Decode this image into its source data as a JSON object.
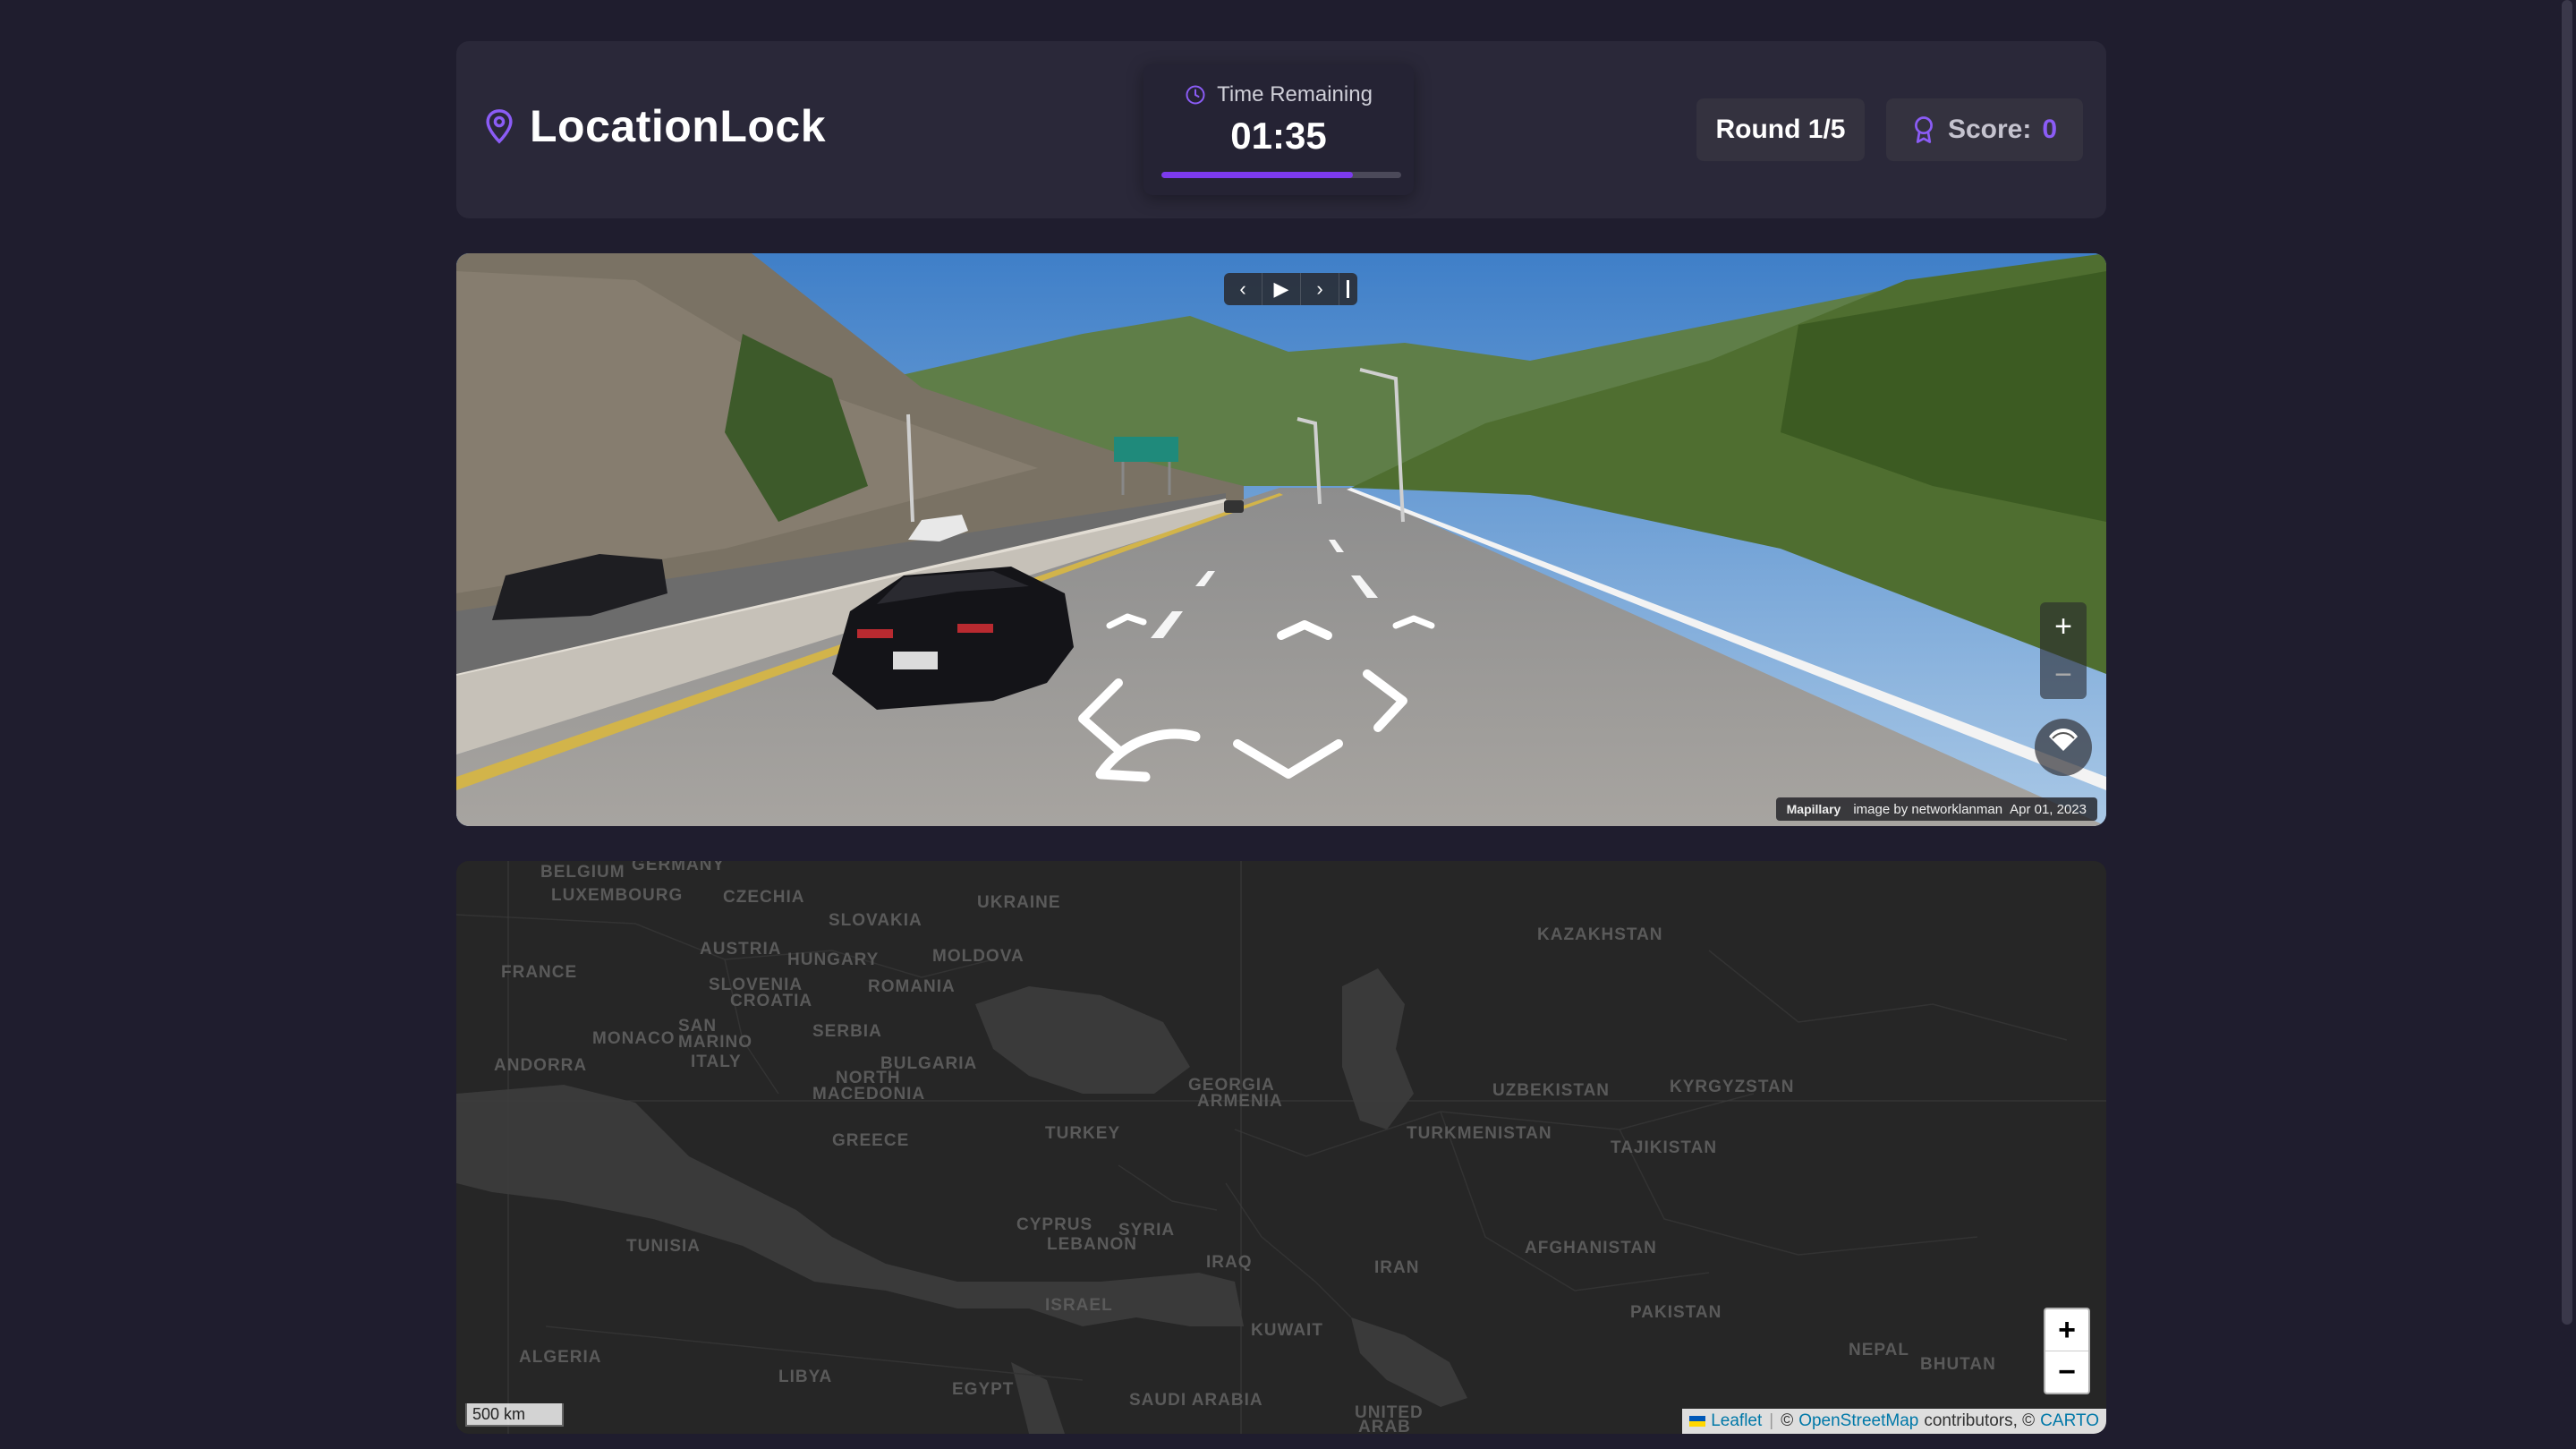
{
  "header": {
    "title": "LocationLock",
    "timer_label": "Time Remaining",
    "timer_value": "01:35",
    "timer_progress": 0.8,
    "round": "Round 1/5",
    "score_label": "Score:",
    "score_value": "0"
  },
  "street_view": {
    "attribution_brand": "Mapillary",
    "attribution_text": "image by networklanman",
    "attribution_date": "Apr 01, 2023",
    "zoom_in": "+",
    "zoom_out": "−"
  },
  "map": {
    "labels": [
      {
        "text": "BELGIUM"
      },
      {
        "text": "GERMANY"
      },
      {
        "text": "LUXEMBOURG"
      },
      {
        "text": "CZECHIA"
      },
      {
        "text": "UKRAINE"
      },
      {
        "text": "SLOVAKIA"
      },
      {
        "text": "KAZAKHSTAN"
      },
      {
        "text": "AUSTRIA"
      },
      {
        "text": "MOLDOVA"
      },
      {
        "text": "HUNGARY"
      },
      {
        "text": "FRANCE"
      },
      {
        "text": "SLOVENIA"
      },
      {
        "text": "ROMANIA"
      },
      {
        "text": "CROATIA"
      },
      {
        "text": "SAN"
      },
      {
        "text": "MONACO"
      },
      {
        "text": "MARINO"
      },
      {
        "text": "SERBIA"
      },
      {
        "text": "ANDORRA"
      },
      {
        "text": "ITALY"
      },
      {
        "text": "BULGARIA"
      },
      {
        "text": "NORTH"
      },
      {
        "text": "MACEDONIA"
      },
      {
        "text": "GEORGIA"
      },
      {
        "text": "UZBEKISTAN"
      },
      {
        "text": "KYRGYZSTAN"
      },
      {
        "text": "ARMENIA"
      },
      {
        "text": "GREECE"
      },
      {
        "text": "TURKEY"
      },
      {
        "text": "TURKMENISTAN"
      },
      {
        "text": "TAJIKISTAN"
      },
      {
        "text": "CYPRUS"
      },
      {
        "text": "SYRIA"
      },
      {
        "text": "LEBANON"
      },
      {
        "text": "AFGHANISTAN"
      },
      {
        "text": "TUNISIA"
      },
      {
        "text": "IRAQ"
      },
      {
        "text": "IRAN"
      },
      {
        "text": "ISRAEL"
      },
      {
        "text": "PAKISTAN"
      },
      {
        "text": "KUWAIT"
      },
      {
        "text": "NEPAL"
      },
      {
        "text": "BHUTAN"
      },
      {
        "text": "ALGERIA"
      },
      {
        "text": "LIBYA"
      },
      {
        "text": "EGYPT"
      },
      {
        "text": "SAUDI ARABIA"
      },
      {
        "text": "UNITED"
      },
      {
        "text": "ARAB"
      }
    ],
    "scale": "500 km",
    "zoom_in": "+",
    "zoom_out": "−",
    "attribution": {
      "leaflet": "Leaflet",
      "copy1": "©",
      "osm": "OpenStreetMap",
      "contributors": "contributors, ©",
      "carto": "CARTO"
    }
  }
}
